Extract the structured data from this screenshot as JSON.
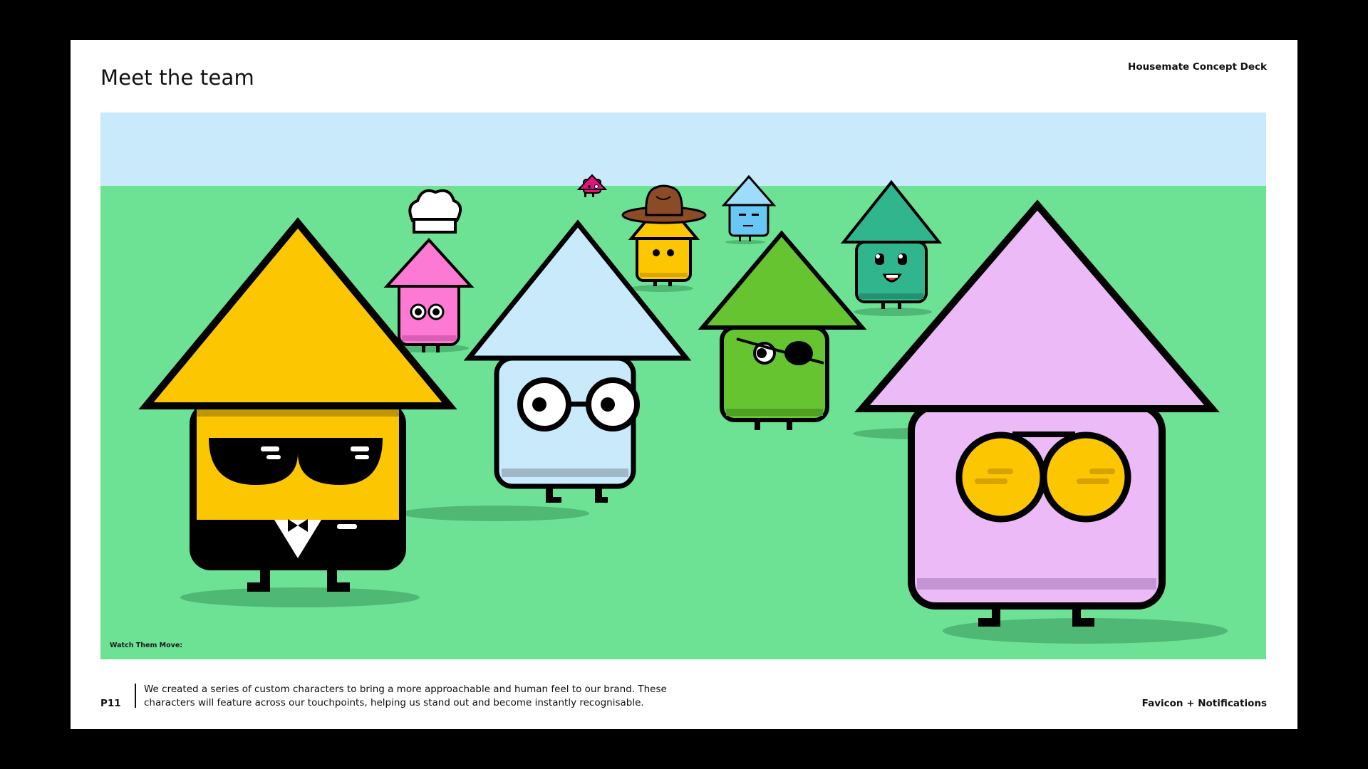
{
  "slide": {
    "title": "Meet the team",
    "deck_name": "Housemate Concept Deck",
    "page_number": "P11",
    "description": "We created a series of custom characters to bring a more approachable and human feel to our brand. These characters will feature across our touchpoints, helping us stand out and become instantly recognisable.",
    "footer_right": "Favicon + Notifications"
  },
  "illustration": {
    "caption": "Watch Them Move:",
    "characters": [
      "yellow-house-sunglasses-tuxedo-icon",
      "pink-house-chef-hat-icon",
      "light-blue-house-round-glasses-icon",
      "magenta-small-house-icon",
      "yellow-house-cowboy-hat-icon",
      "blue-small-house-icon",
      "green-house-eyepatch-icon",
      "teal-house-smiling-icon",
      "lilac-house-yellow-glasses-icon"
    ]
  },
  "colors": {
    "background": "#000000",
    "slide": "#ffffff",
    "sky": "#c8eafb",
    "grass": "#6de295",
    "outline": "#000000"
  }
}
